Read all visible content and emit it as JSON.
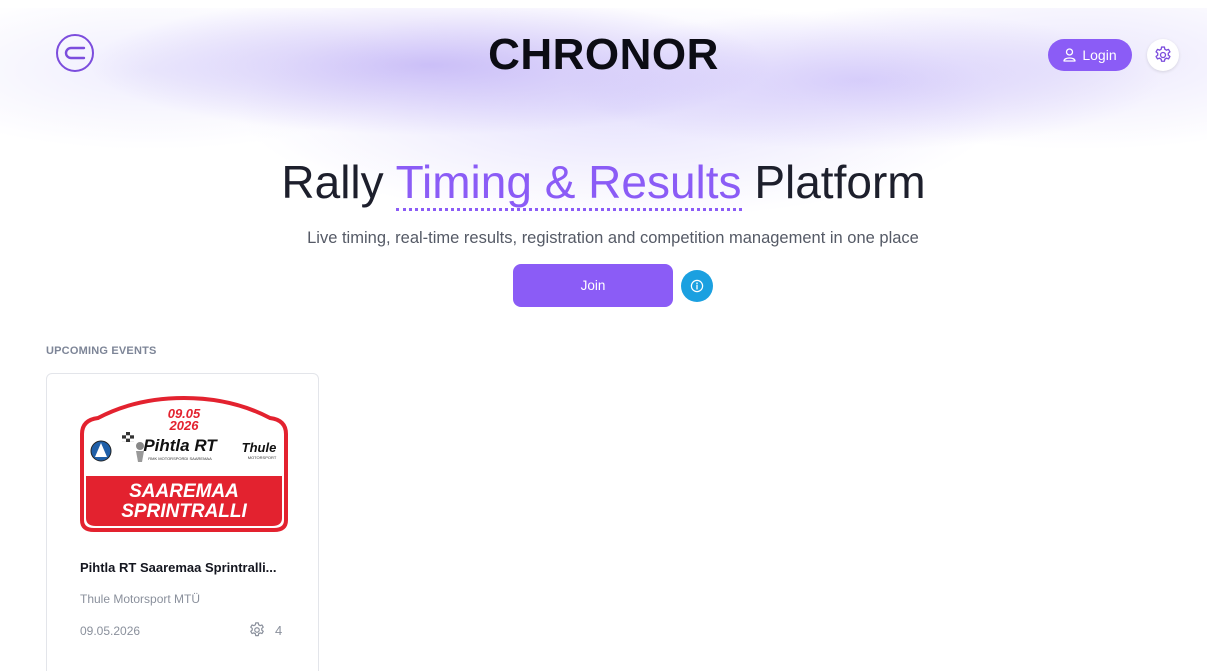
{
  "header": {
    "brand": "CHRONOR",
    "login_label": "Login",
    "logo_glyph": "⊂"
  },
  "hero": {
    "title_pre": "Rally ",
    "title_accent": "Timing & Results",
    "title_post": " Platform",
    "subtitle": "Live timing, real-time results, registration and competition management in one place",
    "join_label": "Join"
  },
  "events": {
    "section_title": "UPCOMING EVENTS",
    "items": [
      {
        "name": "Pihtla RT Saaremaa Sprintralli...",
        "organizer": "Thule Motorsport MTÜ",
        "date": "09.05.2026",
        "count": "4",
        "banner": {
          "date_line1": "09.05",
          "date_line2": "2026",
          "sponsor_main": "Pihtla RT",
          "sponsor_sub": "RMK MOTORSPORDI SAAREMAA",
          "sponsor_right": "Thule",
          "sponsor_right_sub": "MOTORSPORT",
          "title_line1": "SAAREMAA",
          "title_line2": "SPRINTRALLI"
        }
      }
    ]
  },
  "colors": {
    "accent": "#8b5cf6",
    "info": "#1ba0e0",
    "banner_red": "#e3222f"
  }
}
